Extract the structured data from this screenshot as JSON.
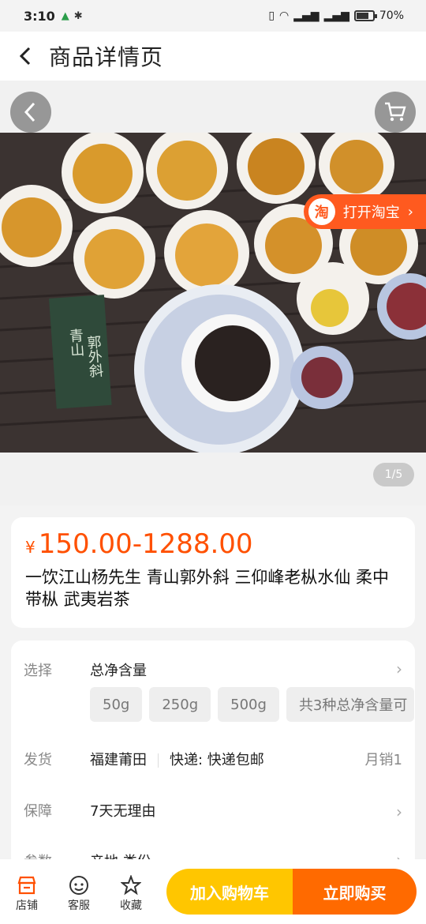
{
  "status_bar": {
    "time": "3:10",
    "battery_text": "70%",
    "battery_level": 0.7
  },
  "nav": {
    "title": "商品详情页"
  },
  "gallery": {
    "taobao_label": "打开淘宝",
    "taobao_badge": "淘",
    "counter": "1/5",
    "photo_text": "青山郭外斜"
  },
  "product": {
    "currency": "¥",
    "price": "150.00-1288.00",
    "title": "一饮江山杨先生 青山郭外斜 三仰峰老枞水仙 柔中带枞 武夷岩茶"
  },
  "specs": {
    "select_label": "选择",
    "select_value": "总净含量",
    "options": [
      "50g",
      "250g",
      "500g",
      "共3种总净含量可"
    ],
    "ship_label": "发货",
    "ship_origin": "福建莆田",
    "ship_method": "快递: 快递包邮",
    "monthly_sales": "月销1",
    "guarantee_label": "保障",
    "guarantee_value": "7天无理由",
    "params_label": "参数",
    "params_value": "产地 类份"
  },
  "bottom": {
    "shop": "店铺",
    "service": "客服",
    "favorite": "收藏",
    "add_cart": "加入购物车",
    "buy_now": "立即购买"
  },
  "colors": {
    "accent": "#ff5000",
    "cart_button": "#ffc600",
    "buy_button": "#ff6a00"
  }
}
